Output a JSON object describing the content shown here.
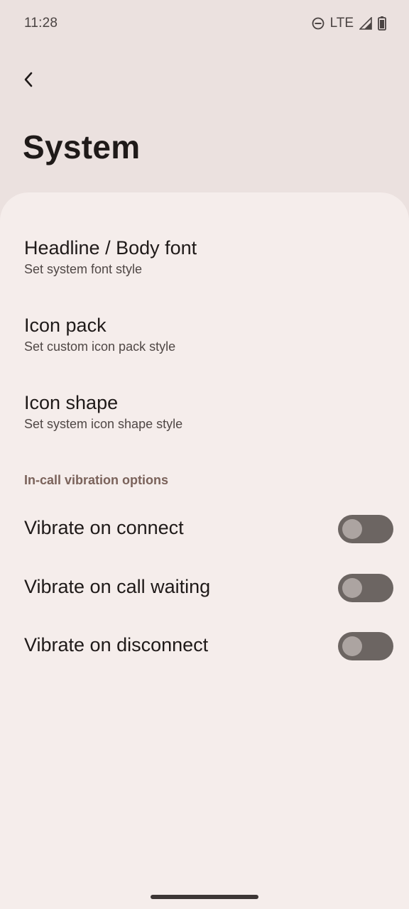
{
  "status_bar": {
    "time": "11:28",
    "network": "LTE",
    "icons": [
      "do-not-disturb-icon",
      "signal-icon",
      "battery-icon"
    ]
  },
  "header": {
    "back_icon": "chevron-left-icon",
    "title": "System"
  },
  "preferences": [
    {
      "title": "Headline / Body font",
      "summary": "Set system font style"
    },
    {
      "title": "Icon pack",
      "summary": "Set custom icon pack style"
    },
    {
      "title": "Icon shape",
      "summary": "Set system icon shape style"
    }
  ],
  "vibration": {
    "section_title": "In-call vibration options",
    "switches": [
      {
        "label": "Vibrate on connect",
        "checked": false
      },
      {
        "label": "Vibrate on call waiting",
        "checked": false
      },
      {
        "label": "Vibrate on disconnect",
        "checked": false
      }
    ]
  },
  "colors": {
    "header_background": "#ebe1df",
    "sheet_background": "#f5edeb",
    "section_accent": "#7a625a",
    "switch_track_off": "#6c6562",
    "switch_thumb_off": "#aca4a1"
  }
}
